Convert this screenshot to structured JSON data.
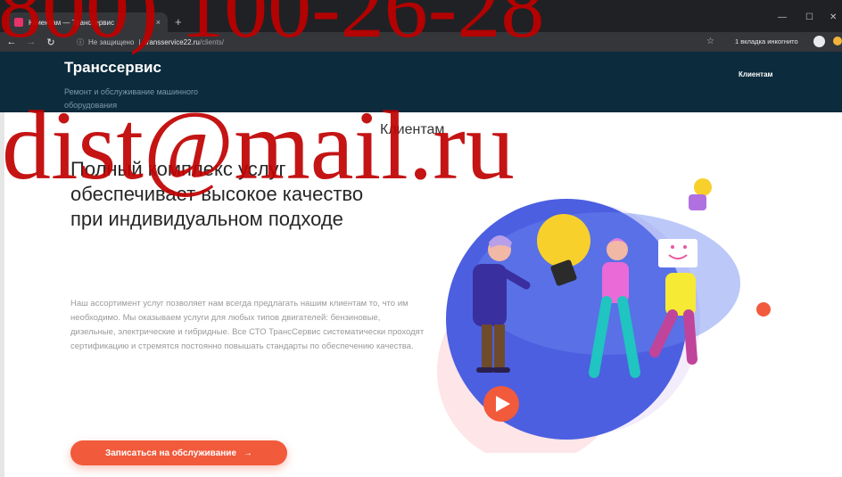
{
  "browser": {
    "tab_title": "Клиентам — Транссервис",
    "tab_close": "×",
    "new_tab": "+",
    "security_label": "Не защищено",
    "url_host": "transservice22.ru",
    "url_path": "/clients/",
    "incognito_label": "1 вкладка инкогнито"
  },
  "site": {
    "brand": "Транссервис",
    "tagline": "Ремонт и обслуживание машинного оборудования",
    "nav": [
      "Клиентам"
    ]
  },
  "content": {
    "heading": "Клиентам",
    "hero_title": "Полный комплекс услуг обеспечивает высокое качество при индивидуальном подходе",
    "hero_text": "Наш ассортимент услуг позволяет нам всегда предлагать нашим клиентам то, что им необходимо. Мы оказываем услуги для любых типов двигателей: бензиновые, дизельные, электрические и гибридные. Все СТО ТрансСервис систематически проходят сертификацию и стремятся постоянно повышать стандарты по обеспечению качества.",
    "cta_label": "Записаться на обслуживание",
    "cta_arrow": "→"
  },
  "watermark": {
    "phone": "800) 100-26-28",
    "email": "dist@mail.ru"
  },
  "colors": {
    "header_bg": "#0c2b3d",
    "accent": "#f15a3b",
    "watermark": "#c00000"
  }
}
